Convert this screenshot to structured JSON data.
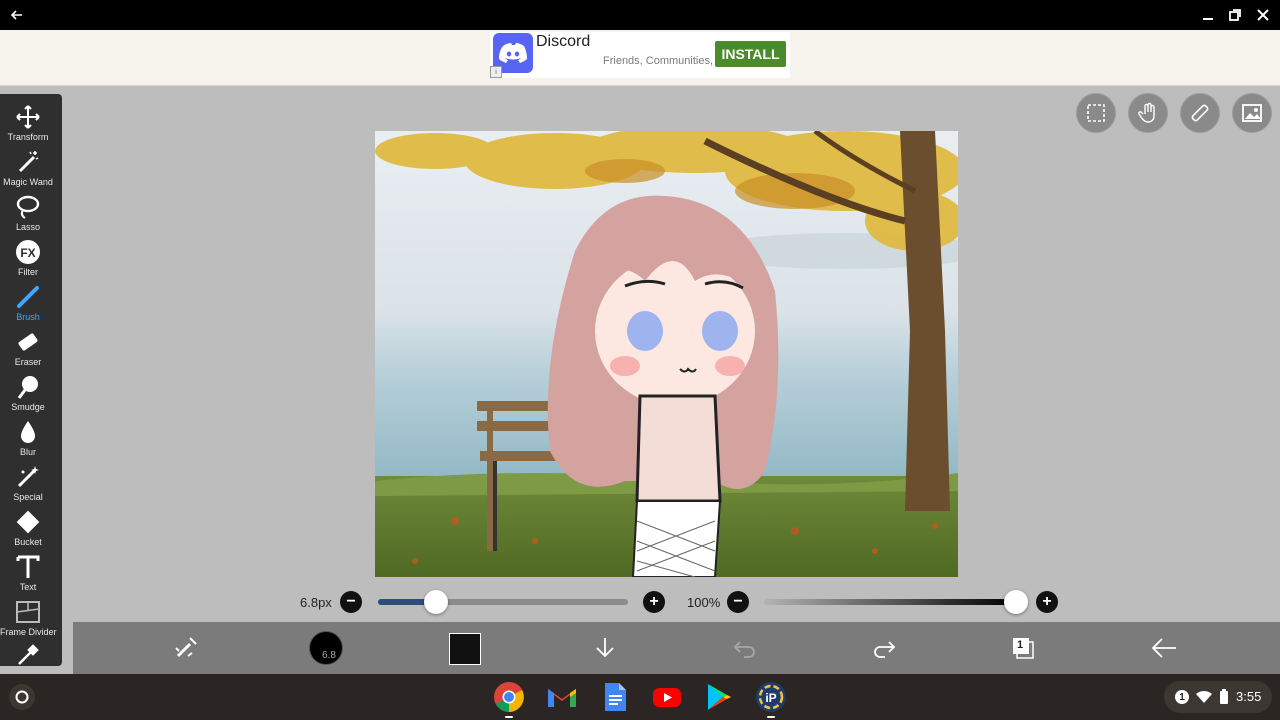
{
  "ad": {
    "title": "Discord",
    "subtitle": "Friends, Communities,",
    "install_label": "INSTALL"
  },
  "tools": [
    {
      "label": "Transform",
      "icon": "move-icon"
    },
    {
      "label": "Magic Wand",
      "icon": "magic-wand-icon"
    },
    {
      "label": "Lasso",
      "icon": "lasso-icon"
    },
    {
      "label": "Filter",
      "icon": "fx-icon"
    },
    {
      "label": "Brush",
      "icon": "brush-icon",
      "active": true
    },
    {
      "label": "Eraser",
      "icon": "eraser-icon"
    },
    {
      "label": "Smudge",
      "icon": "smudge-icon"
    },
    {
      "label": "Blur",
      "icon": "blur-drop-icon"
    },
    {
      "label": "Special",
      "icon": "special-icon"
    },
    {
      "label": "Bucket",
      "icon": "bucket-icon"
    },
    {
      "label": "Text",
      "icon": "text-icon"
    },
    {
      "label": "Frame Divider",
      "icon": "frame-divider-icon"
    }
  ],
  "brush_size": {
    "label": "6.8px",
    "fraction": 0.23
  },
  "opacity": {
    "label": "100%",
    "fraction": 1.0
  },
  "brush_preview_value": "6.8",
  "layer_count": "1",
  "colors": {
    "accent": "#3ea6ff",
    "current_color": "#111111",
    "install_green": "#4c8b2b",
    "discord": "#5865f2"
  },
  "shelf": {
    "apps": [
      "chrome-icon",
      "gmail-icon",
      "docs-icon",
      "youtube-icon",
      "play-store-icon",
      "ibispaint-icon"
    ],
    "notification_count": "1",
    "time": "3:55"
  }
}
